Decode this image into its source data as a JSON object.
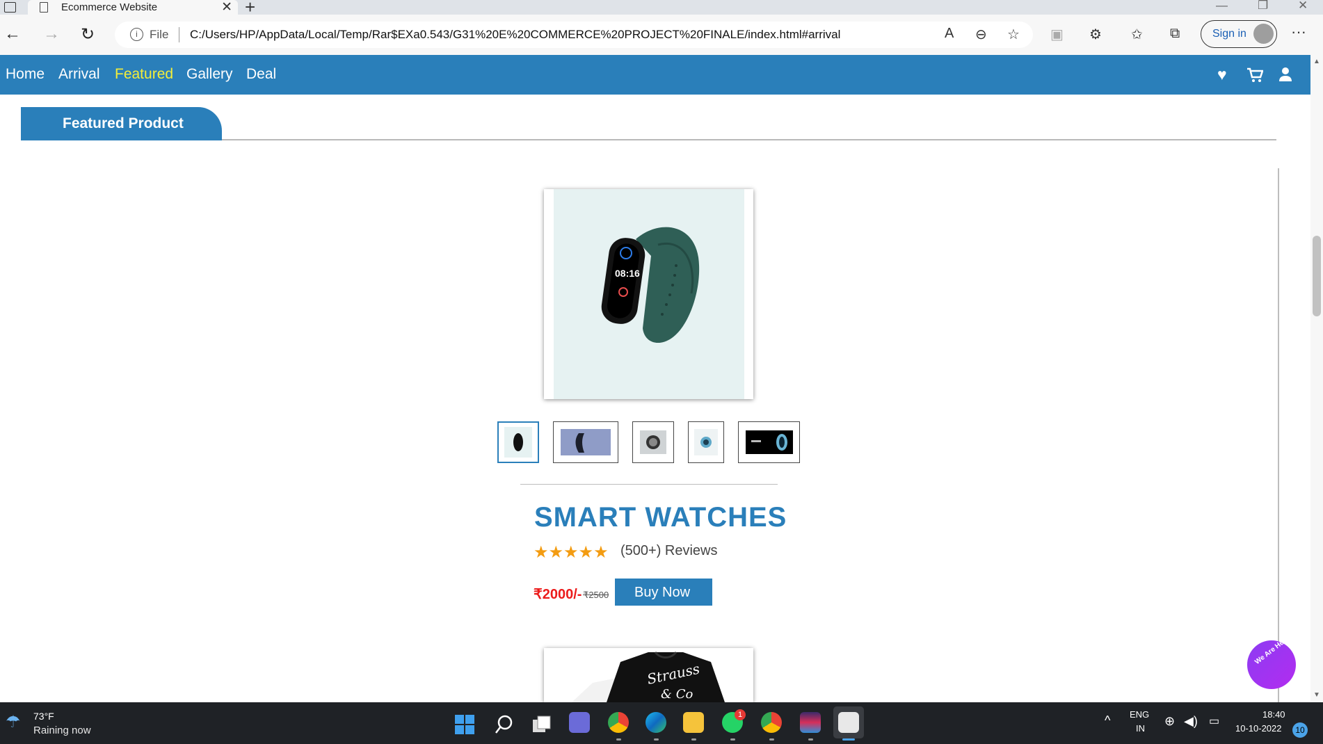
{
  "browser": {
    "tab_title": "Ecommerce Website",
    "tab_close": "✕",
    "new_tab": "+",
    "address_prefix": "File",
    "url": "C:/Users/HP/AppData/Local/Temp/Rar$EXa0.543/G31%20E%20COMMERCE%20PROJECT%20FINALE/index.html#arrival",
    "sign_in": "Sign in"
  },
  "site_nav": {
    "links": [
      "Home",
      "Arrival",
      "Featured",
      "Gallery",
      "Deal"
    ],
    "active": "Featured",
    "icons": [
      "heart-icon",
      "cart-icon",
      "user-icon"
    ]
  },
  "section": {
    "heading": "Featured Product"
  },
  "product": {
    "title": "SMART WATCHES",
    "rating": 5,
    "reviews": "(500+) Reviews",
    "price": "₹2000/-",
    "old_price": "₹2500",
    "buy_label": "Buy Now",
    "thumbnails": [
      "band-front",
      "band-blue-bg",
      "watch-dark",
      "watch-round",
      "watch-banner"
    ]
  },
  "chat_widget": {
    "label": "We Are Here!"
  },
  "taskbar": {
    "temperature": "73°F",
    "weather": "Raining now",
    "whatsapp_badge": "1",
    "language": "ENG",
    "region": "IN",
    "time": "18:40",
    "date": "10-10-2022",
    "notifications": "10"
  },
  "colors": {
    "brand_blue": "#2a7fba",
    "active_link": "#f4ee3a",
    "price_red": "#ec1c1c",
    "star": "#f39c12"
  }
}
